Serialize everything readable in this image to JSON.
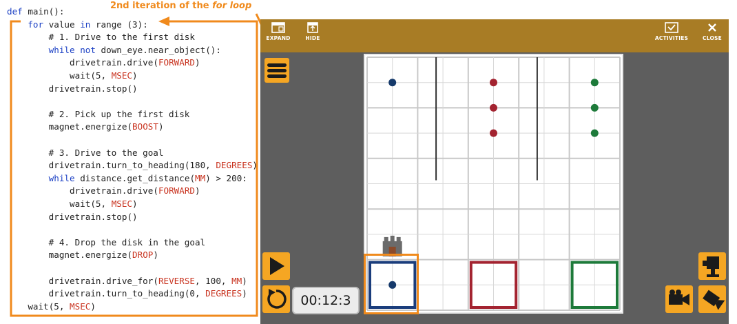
{
  "annotation": {
    "prefix": "2nd iteration of the ",
    "emphasis": "for loop",
    "color": "#f08a1c"
  },
  "code": {
    "lines": [
      "def main():",
      "    for value in range (3):",
      "        # 1. Drive to the first disk",
      "        while not down_eye.near_object():",
      "            drivetrain.drive(FORWARD)",
      "            wait(5, MSEC)",
      "        drivetrain.stop()",
      "",
      "        # 2. Pick up the first disk",
      "        magnet.energize(BOOST)",
      "",
      "        # 3. Drive to the goal",
      "        drivetrain.turn_to_heading(180, DEGREES)",
      "        while distance.get_distance(MM) > 200:",
      "            drivetrain.drive(FORWARD)",
      "            wait(5, MSEC)",
      "        drivetrain.stop()",
      "",
      "        # 4. Drop the disk in the goal",
      "        magnet.energize(DROP)",
      "",
      "        drivetrain.drive_for(REVERSE, 100, MM)",
      "        drivetrain.turn_to_heading(0, DEGREES)",
      "    wait(5, MSEC)"
    ],
    "keyword_color": "#1a3fc4",
    "constant_color": "#c8321e"
  },
  "toolbar": {
    "expand_label": "EXPAND",
    "hide_label": "HIDE",
    "activities_label": "ACTIVITIES",
    "close_label": "CLOSE",
    "color": "#a87c25"
  },
  "playground": {
    "timer": "00:12:3",
    "background": "#5e5e5e",
    "grid_rows": 10,
    "grid_cols": 10,
    "disks": [
      {
        "color": "#163a6b",
        "col": 1,
        "row": 1
      },
      {
        "color": "#a32330",
        "col": 5,
        "row": 1
      },
      {
        "color": "#a32330",
        "col": 5,
        "row": 2
      },
      {
        "color": "#a32330",
        "col": 5,
        "row": 3
      },
      {
        "color": "#1d7a3a",
        "col": 9,
        "row": 1
      },
      {
        "color": "#1d7a3a",
        "col": 9,
        "row": 2
      },
      {
        "color": "#1d7a3a",
        "col": 9,
        "row": 3
      },
      {
        "color": "#163a6b",
        "col": 1,
        "row": 9
      }
    ],
    "goals": [
      {
        "name": "blue",
        "color": "#1a3d7c"
      },
      {
        "name": "red",
        "color": "#a32330"
      },
      {
        "name": "green",
        "color": "#1d7a3a"
      }
    ]
  }
}
